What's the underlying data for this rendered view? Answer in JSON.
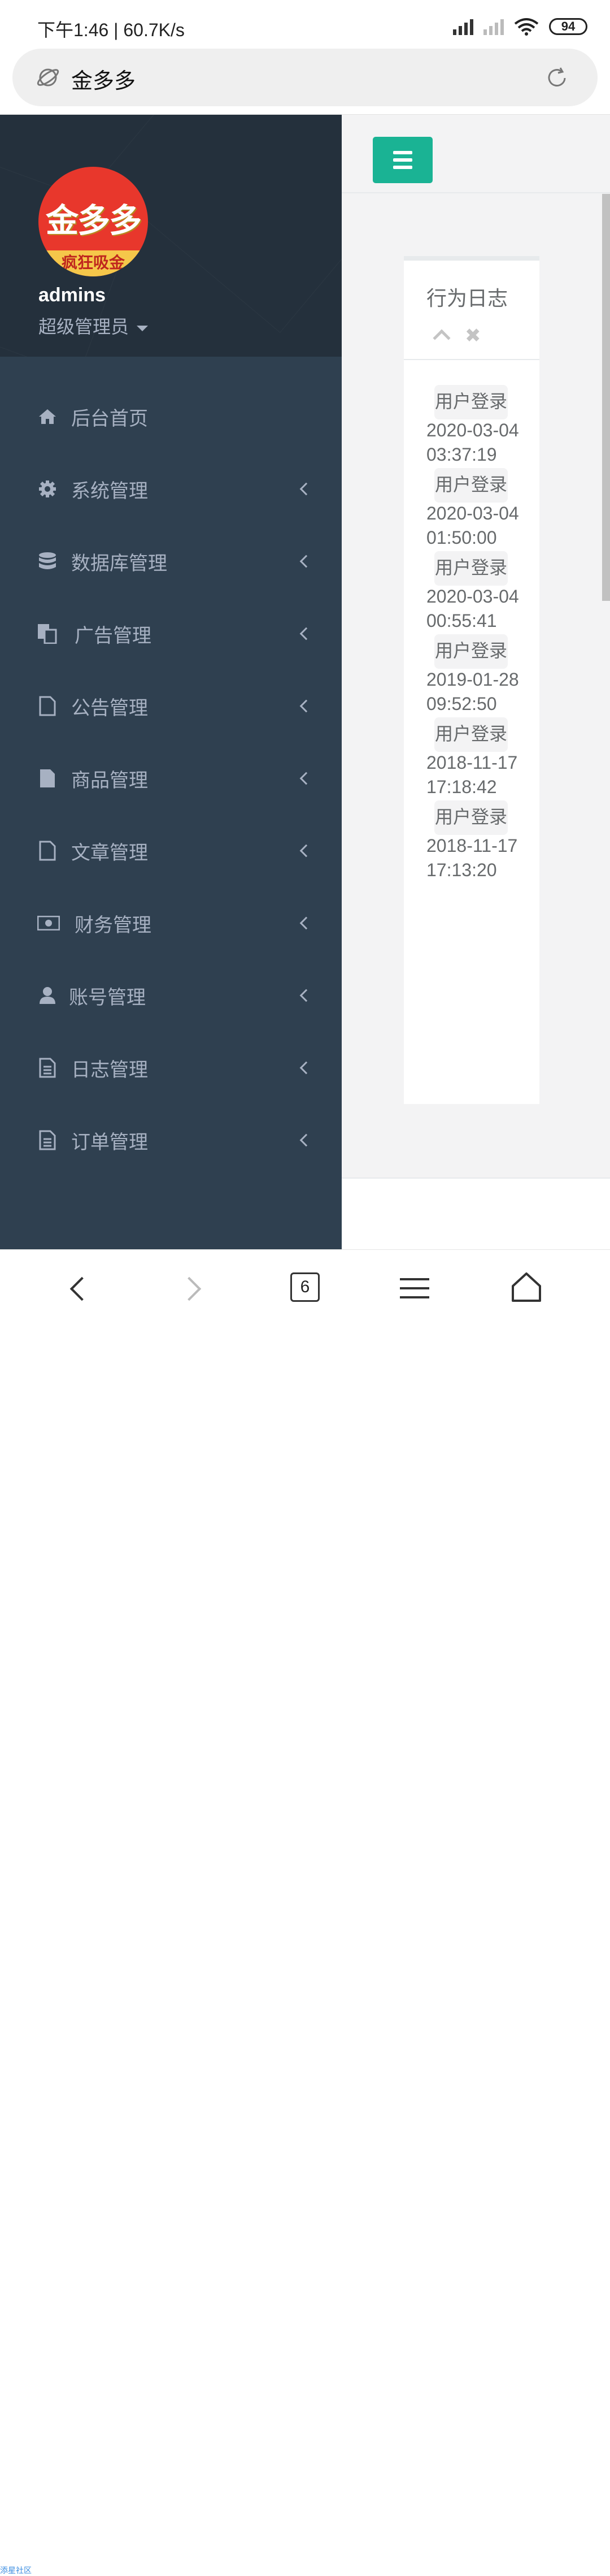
{
  "status_bar": {
    "time_speed": "下午1:46 | 60.7K/s",
    "battery": "94"
  },
  "address_bar": {
    "title": "金多多"
  },
  "sidebar": {
    "avatar_text": "金多多",
    "avatar_subtext": "疯狂吸金",
    "username": "admins",
    "role": "超级管理员",
    "items": [
      {
        "label": "后台首页",
        "icon": "home-icon"
      },
      {
        "label": "系统管理",
        "icon": "gear-icon"
      },
      {
        "label": "数据库管理",
        "icon": "database-icon"
      },
      {
        "label": "广告管理",
        "icon": "copy-icon"
      },
      {
        "label": "公告管理",
        "icon": "file-outline-icon"
      },
      {
        "label": "商品管理",
        "icon": "file-icon"
      },
      {
        "label": "文章管理",
        "icon": "file-outline-icon"
      },
      {
        "label": "财务管理",
        "icon": "money-icon"
      },
      {
        "label": "账号管理",
        "icon": "user-icon"
      },
      {
        "label": "日志管理",
        "icon": "file-text-icon"
      },
      {
        "label": "订单管理",
        "icon": "file-text-icon"
      }
    ]
  },
  "panel": {
    "title": "行为日志",
    "entries": [
      {
        "action": "用户登录",
        "date": "2020-03-04",
        "time": "03:37:19"
      },
      {
        "action": "用户登录",
        "date": "2020-03-04",
        "time": "01:50:00"
      },
      {
        "action": "用户登录",
        "date": "2020-03-04",
        "time": "00:55:41"
      },
      {
        "action": "用户登录",
        "date": "2019-01-28",
        "time": "09:52:50"
      },
      {
        "action": "用户登录",
        "date": "2018-11-17",
        "time": "17:18:42"
      },
      {
        "action": "用户登录",
        "date": "2018-11-17",
        "time": "17:13:20"
      }
    ]
  },
  "navbar": {
    "tab_count": "6"
  },
  "watermark": "添星社区",
  "colors": {
    "sidebar": "#2f4050",
    "sidebar_header": "#24303c",
    "accent": "#1ab394",
    "text_muted": "#a7b1c2"
  }
}
